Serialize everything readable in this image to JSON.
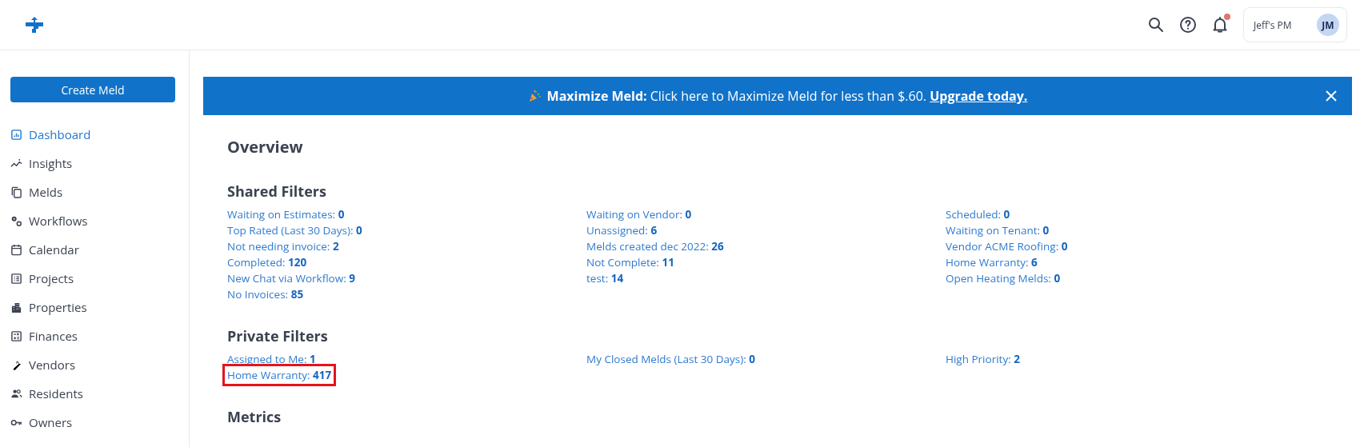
{
  "header": {
    "account": {
      "name": "Jeff's PM",
      "initials": "JM"
    },
    "notifications": {
      "unread": true
    }
  },
  "sidebar": {
    "create_button": "Create Meld",
    "items": [
      {
        "label": "Dashboard",
        "selected": true
      },
      {
        "label": "Insights",
        "selected": false
      },
      {
        "label": "Melds",
        "selected": false
      },
      {
        "label": "Workflows",
        "selected": false
      },
      {
        "label": "Calendar",
        "selected": false
      },
      {
        "label": "Projects",
        "selected": false
      },
      {
        "label": "Properties",
        "selected": false
      },
      {
        "label": "Finances",
        "selected": false
      },
      {
        "label": "Vendors",
        "selected": false
      },
      {
        "label": "Residents",
        "selected": false
      },
      {
        "label": "Owners",
        "selected": false
      }
    ]
  },
  "banner": {
    "text": "**Maximize Meld:** Click here to Maximize Meld for less than $.60.",
    "link": "Upgrade today."
  },
  "title": "Overview",
  "sections": [
    {
      "title": "Shared Filters",
      "columns": [
        [
          {
            "label": "Waiting on Estimates:",
            "count": "0",
            "highlighted": false
          },
          {
            "label": "Top Rated (Last 30 Days):",
            "count": "0",
            "highlighted": false
          },
          {
            "label": "Not needing invoice:",
            "count": "2",
            "highlighted": false
          },
          {
            "label": "Completed:",
            "count": "120",
            "highlighted": false
          },
          {
            "label": "New Chat via Workflow:",
            "count": "9",
            "highlighted": false
          },
          {
            "label": "No Invoices:",
            "count": "85",
            "highlighted": false
          }
        ],
        [
          {
            "label": "Waiting on Vendor:",
            "count": "0",
            "highlighted": false
          },
          {
            "label": "Unassigned:",
            "count": "6",
            "highlighted": false
          },
          {
            "label": "Melds created dec 2022:",
            "count": "26",
            "highlighted": false
          },
          {
            "label": "Not Complete:",
            "count": "11",
            "highlighted": false
          },
          {
            "label": "test:",
            "count": "14",
            "highlighted": false
          }
        ],
        [
          {
            "label": "Scheduled:",
            "count": "0",
            "highlighted": false
          },
          {
            "label": "Waiting on Tenant:",
            "count": "0",
            "highlighted": false
          },
          {
            "label": "Vendor ACME Roofing:",
            "count": "0",
            "highlighted": false
          },
          {
            "label": "Home Warranty:",
            "count": "6",
            "highlighted": false
          },
          {
            "label": "Open Heating Melds:",
            "count": "0",
            "highlighted": false
          }
        ]
      ]
    },
    {
      "title": "Private Filters",
      "columns": [
        [
          {
            "label": "Assigned to Me:",
            "count": "1",
            "highlighted": false
          },
          {
            "label": "Home Warranty:",
            "count": "417",
            "highlighted": true
          }
        ],
        [
          {
            "label": "My Closed Melds (Last 30 Days):",
            "count": "0",
            "highlighted": false
          }
        ],
        [
          {
            "label": "High Priority:",
            "count": "2",
            "highlighted": false
          }
        ]
      ]
    }
  ],
  "next_title": "Metrics"
}
